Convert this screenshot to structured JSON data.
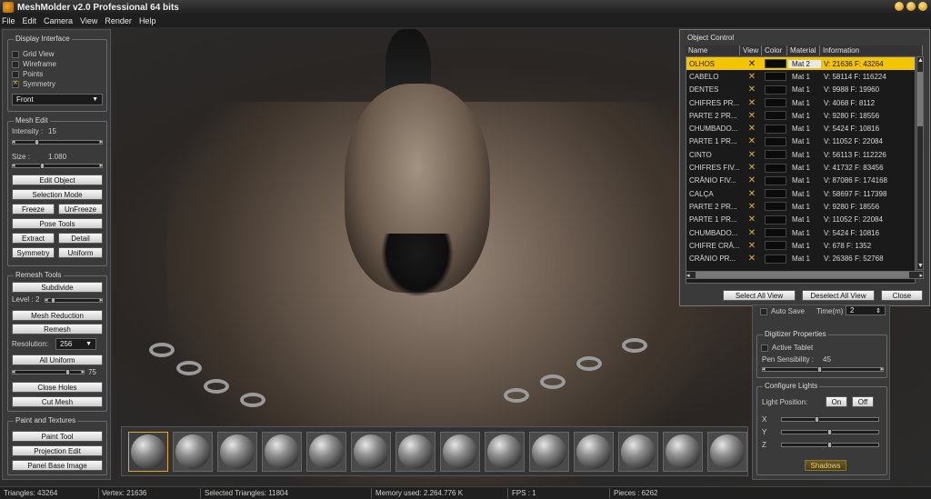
{
  "window": {
    "title": "MeshMolder v2.0 Professional 64 bits"
  },
  "menu": [
    "File",
    "Edit",
    "Camera",
    "View",
    "Render",
    "Help"
  ],
  "display_interface": {
    "title": "Display Interface",
    "grid_view": "Grid View",
    "wireframe": "Wireframe",
    "points": "Points",
    "symmetry": "Symmetry",
    "view_select": "Front"
  },
  "mesh_edit": {
    "title": "Mesh Edit",
    "intensity_label": "Intensity :",
    "intensity_value": "15",
    "size_label": "Size :",
    "size_value": "1.080",
    "edit_object": "Edit Object",
    "selection_mode": "Selection Mode",
    "freeze": "Freeze",
    "unfreeze": "UnFreeze",
    "pose_tools": "Pose Tools",
    "extract": "Extract",
    "detail": "Detail",
    "symmetry": "Symmetry",
    "uniform": "Uniform"
  },
  "remesh_tools": {
    "title": "Remesh Tools",
    "subdivide": "Subdivide",
    "level_label": "Level :",
    "level_value": "2",
    "mesh_reduction": "Mesh Reduction",
    "remesh": "Remesh",
    "resolution_label": "Resolution:",
    "resolution_value": "256",
    "all_uniform": "All Uniform",
    "uniform_value": "75",
    "close_holes": "Close Holes",
    "cut_mesh": "Cut Mesh"
  },
  "paint_textures": {
    "title": "Paint and Textures",
    "paint_tool": "Paint Tool",
    "projection_edit": "Projection Edit",
    "panel_base_image": "Panel Base Image"
  },
  "object_control": {
    "title": "Object Control",
    "columns": [
      "Name",
      "View",
      "Color",
      "Material",
      "Information"
    ],
    "rows": [
      {
        "name": "OLHOS",
        "material": "Mat 2",
        "info": "V: 21636 F: 43264",
        "selected": true
      },
      {
        "name": "CABELO",
        "material": "Mat 1",
        "info": "V: 58114 F: 116224"
      },
      {
        "name": "DENTES",
        "material": "Mat 1",
        "info": "V: 9988 F: 19960"
      },
      {
        "name": "CHIFRES PR...",
        "material": "Mat 1",
        "info": "V: 4068 F: 8112"
      },
      {
        "name": "PARTE 2 PR...",
        "material": "Mat 1",
        "info": "V: 9280 F: 18556"
      },
      {
        "name": "CHUMBADO...",
        "material": "Mat 1",
        "info": "V: 5424 F: 10816"
      },
      {
        "name": "PARTE 1 PR...",
        "material": "Mat 1",
        "info": "V: 11052 F: 22084"
      },
      {
        "name": "CINTO",
        "material": "Mat 1",
        "info": "V: 56113 F: 112226"
      },
      {
        "name": "CHIFRES FIV...",
        "material": "Mat 1",
        "info": "V: 41732 F: 83456"
      },
      {
        "name": "CRÂNIO FIV...",
        "material": "Mat 1",
        "info": "V: 87086 F: 174168"
      },
      {
        "name": "CALÇA",
        "material": "Mat 1",
        "info": "V: 58697 F: 117398"
      },
      {
        "name": "PARTE 2 PR...",
        "material": "Mat 1",
        "info": "V: 9280 F: 18556"
      },
      {
        "name": "PARTE 1 PR...",
        "material": "Mat 1",
        "info": "V: 11052 F: 22084"
      },
      {
        "name": "CHUMBADO...",
        "material": "Mat 1",
        "info": "V: 5424 F: 10816"
      },
      {
        "name": "CHIFRE CRÂ...",
        "material": "Mat 1",
        "info": "V: 678 F: 1352"
      },
      {
        "name": "CRÂNIO PR...",
        "material": "Mat 1",
        "info": "V: 26386 F: 52768"
      }
    ],
    "select_all": "Select All View",
    "deselect_all": "Deselect All View",
    "close": "Close"
  },
  "autosave": {
    "label": "Auto Save",
    "time_label": "Time(m)",
    "time_value": "2"
  },
  "digitizer": {
    "title": "Digitizer Properties",
    "active_tablet": "Active Tablet",
    "pen_label": "Pen Sensibility :",
    "pen_value": "45"
  },
  "lights": {
    "title": "Configure Lights",
    "position_label": "Light Position:",
    "on": "On",
    "off": "Off",
    "x": "X",
    "y": "Y",
    "z": "Z",
    "shadows": "Shadows"
  },
  "status": {
    "triangles": "Triangles: 43264",
    "vertex": "Vertex: 21636",
    "selected": "Selected Triangles: 11804",
    "memory": "Memory used: 2.264.776 K",
    "fps": "FPS : 1",
    "pieces": "Pieces : 6262"
  }
}
